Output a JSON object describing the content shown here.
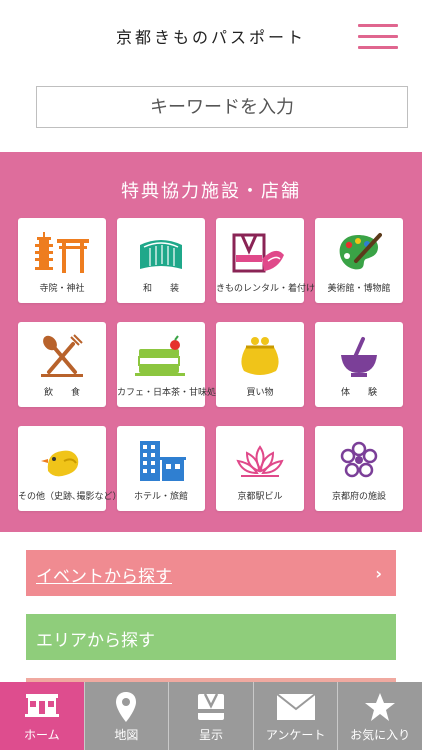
{
  "app": {
    "title": "京都きものパスポート"
  },
  "search": {
    "placeholder": "キーワードを入力"
  },
  "categories": {
    "title": "特典協力施設・店舗",
    "items": [
      {
        "label": "寺院・神社",
        "icon": "torii-pagoda-icon"
      },
      {
        "label": "和　　装",
        "icon": "obi-icon"
      },
      {
        "label": "きものレンタル・着付け",
        "icon": "kimono-icon"
      },
      {
        "label": "美術館・博物館",
        "icon": "palette-icon"
      },
      {
        "label": "飲　　食",
        "icon": "fork-spoon-icon"
      },
      {
        "label": "カフェ・日本茶・甘味処",
        "icon": "cake-icon"
      },
      {
        "label": "買い物",
        "icon": "purse-icon"
      },
      {
        "label": "体　　験",
        "icon": "tea-bowl-icon"
      },
      {
        "label": "その他（史跡､撮影など）",
        "icon": "bird-icon"
      },
      {
        "label": "ホテル・旅館",
        "icon": "hotel-icon"
      },
      {
        "label": "京都駅ビル",
        "icon": "lotus-icon"
      },
      {
        "label": "京都府の施設",
        "icon": "flower-crest-icon"
      }
    ]
  },
  "actions": {
    "event": "イベントから探す",
    "area": "エリアから探す",
    "arrow": "›"
  },
  "tabs": [
    {
      "label": "ホーム",
      "icon": "home-icon"
    },
    {
      "label": "地図",
      "icon": "map-pin-icon"
    },
    {
      "label": "呈示",
      "icon": "kimono-card-icon"
    },
    {
      "label": "アンケート",
      "icon": "envelope-icon"
    },
    {
      "label": "お気に入り",
      "icon": "star-icon"
    }
  ],
  "colors": {
    "accent": "#de6d9c",
    "tab_active": "#de4d8e",
    "event_button": "#f08b91",
    "area_button": "#8fcd7b",
    "tabbar": "#9a9a9a"
  }
}
